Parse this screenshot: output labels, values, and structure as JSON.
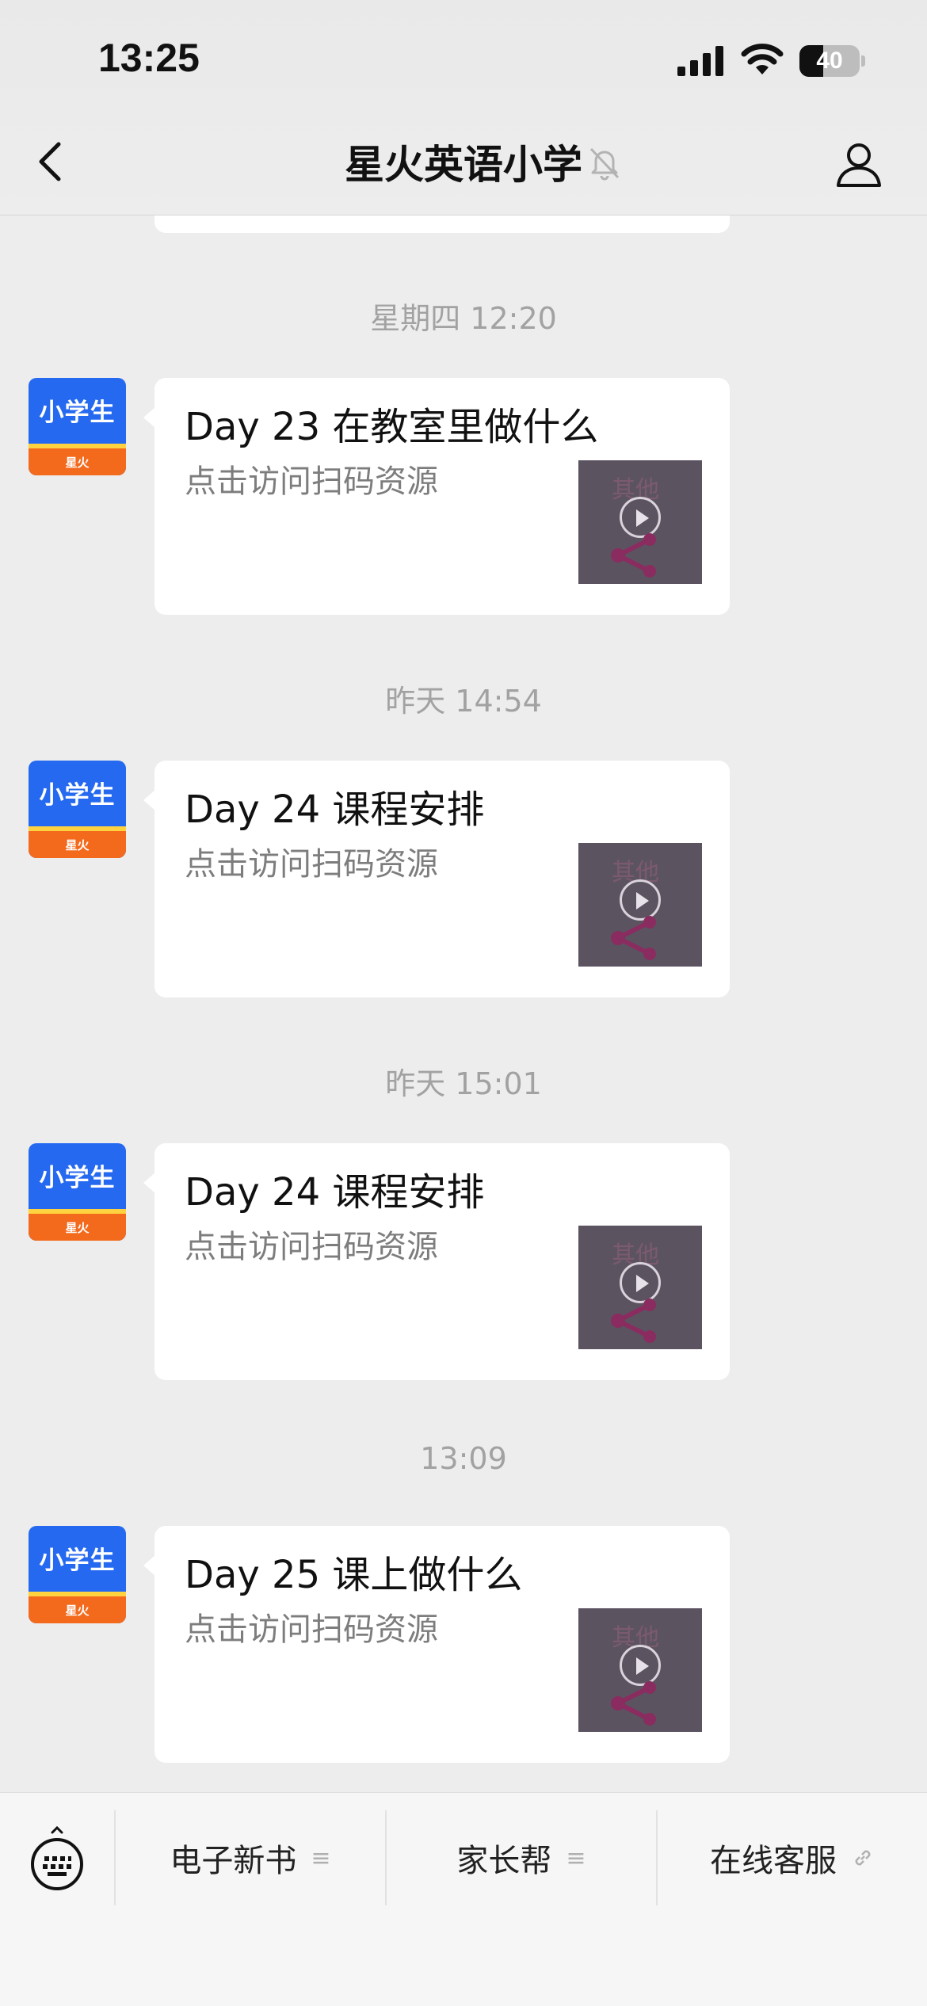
{
  "status_bar": {
    "time": "13:25",
    "battery": 40
  },
  "nav": {
    "title": "星火英语小学"
  },
  "avatar": {
    "brand": "小学生",
    "sub": "星火"
  },
  "messages": [
    {
      "time": "星期四 12:20",
      "title": "Day 23 在教室里做什么",
      "desc": "点击访问扫码资源",
      "thumb_text": "其他"
    },
    {
      "time": "昨天 14:54",
      "title": "Day 24 课程安排",
      "desc": "点击访问扫码资源",
      "thumb_text": "其他"
    },
    {
      "time": "昨天 15:01",
      "title": "Day 24 课程安排",
      "desc": "点击访问扫码资源",
      "thumb_text": "其他"
    },
    {
      "time": "13:09",
      "title": "Day 25 课上做什么",
      "desc": "点击访问扫码资源",
      "thumb_text": "其他"
    }
  ],
  "menu": [
    {
      "label": "电子新书",
      "icon": "list-icon"
    },
    {
      "label": "家长帮",
      "icon": "list-icon"
    },
    {
      "label": "在线客服",
      "icon": "link-icon"
    }
  ],
  "colors": {
    "background": "#ededed",
    "avatar_blue": "#2469f0",
    "avatar_orange": "#f36a1d"
  }
}
